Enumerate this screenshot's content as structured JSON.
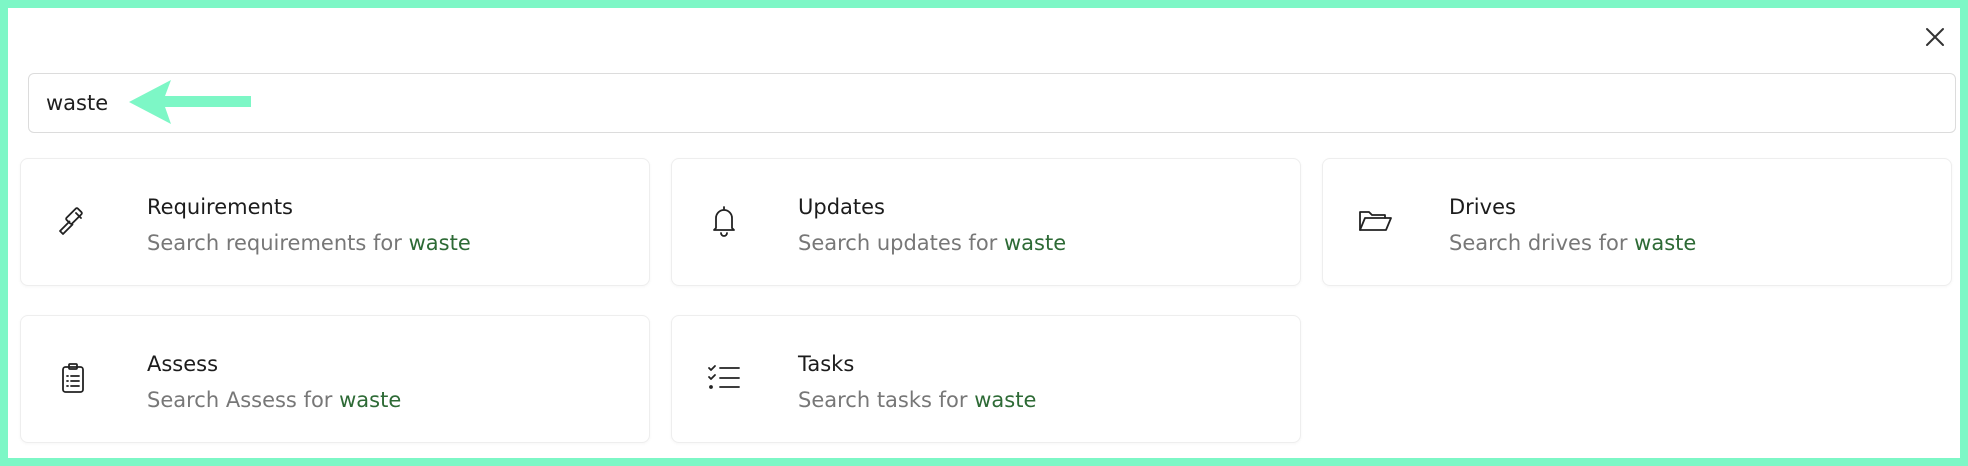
{
  "search": {
    "value": "waste",
    "query": "waste"
  },
  "close": {
    "icon": "close-icon"
  },
  "colors": {
    "frame": "#7df7c6",
    "arrow": "#7df7c6",
    "highlight": "#2d6a35",
    "subtitle": "#777777"
  },
  "cards": [
    {
      "title": "Requirements",
      "prefix": "Search requirements for",
      "term": "waste",
      "icon": "gavel-icon"
    },
    {
      "title": "Updates",
      "prefix": "Search updates for",
      "term": "waste",
      "icon": "bell-icon"
    },
    {
      "title": "Drives",
      "prefix": "Search drives for",
      "term": "waste",
      "icon": "folder-open-icon"
    },
    {
      "title": "Assess",
      "prefix": "Search Assess for",
      "term": "waste",
      "icon": "clipboard-list-icon"
    },
    {
      "title": "Tasks",
      "prefix": "Search tasks for",
      "term": "waste",
      "icon": "checklist-icon"
    }
  ]
}
